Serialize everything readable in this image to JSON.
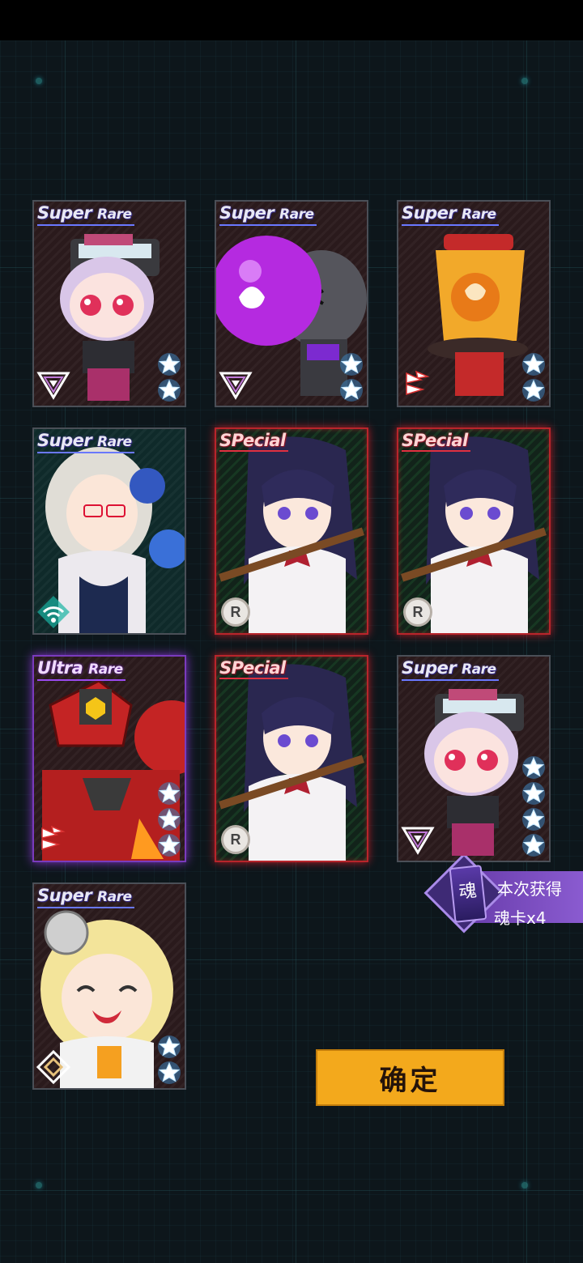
{
  "cards": [
    {
      "rarity_main": "Super",
      "rarity_sub": "Rare",
      "stars": 2,
      "class": "triangle",
      "theme": "pink-girl"
    },
    {
      "rarity_main": "Super",
      "rarity_sub": "Rare",
      "stars": 2,
      "class": "triangle",
      "theme": "purple-bomb"
    },
    {
      "rarity_main": "Super",
      "rarity_sub": "Rare",
      "stars": 2,
      "class": "claw",
      "theme": "orange-lantern"
    },
    {
      "rarity_main": "Super",
      "rarity_sub": "Rare",
      "stars": 0,
      "class": "wifi",
      "theme": "silver-girl"
    },
    {
      "rarity_main": "SPecial",
      "rarity_sub": "",
      "stars": 0,
      "badge": "R",
      "theme": "schoolgirl"
    },
    {
      "rarity_main": "SPecial",
      "rarity_sub": "",
      "stars": 0,
      "badge": "R",
      "theme": "schoolgirl"
    },
    {
      "rarity_main": "Ultra",
      "rarity_sub": "Rare",
      "stars": 3,
      "class": "claw",
      "theme": "red-mech"
    },
    {
      "rarity_main": "SPecial",
      "rarity_sub": "",
      "stars": 0,
      "badge": "R",
      "theme": "schoolgirl"
    },
    {
      "rarity_main": "Super",
      "rarity_sub": "Rare",
      "stars": 4,
      "class": "triangle",
      "theme": "pink-girl"
    },
    {
      "rarity_main": "Super",
      "rarity_sub": "Rare",
      "stars": 2,
      "class": "diamond",
      "theme": "blonde-girl"
    }
  ],
  "gain": {
    "soul_glyph": "魂",
    "title": "本次获得",
    "count": "魂卡x4"
  },
  "confirm_label": "确定",
  "colors": {
    "confirm": "#f3a91c",
    "special_border": "#b8252b",
    "ultra_border": "#7a3bbd",
    "star": "#ffffff"
  }
}
